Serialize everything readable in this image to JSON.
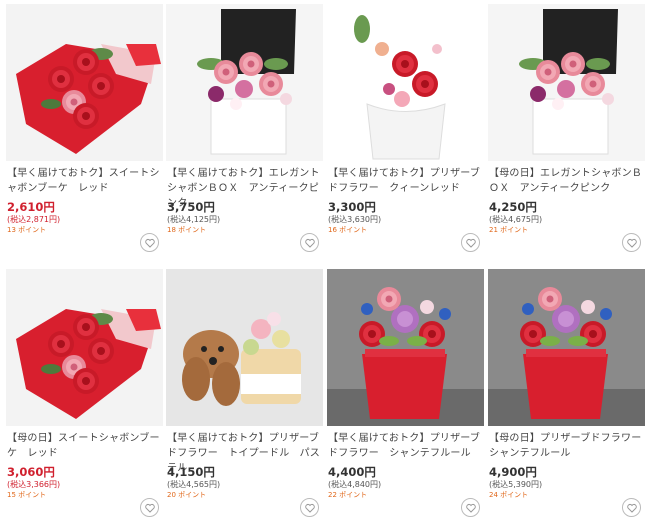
{
  "products": [
    {
      "name": "【早く届けておトク】スイートシャボンブーケ　レッド",
      "price": "2,610円",
      "tax": "(税込2,871円)",
      "points": "13 ポイント",
      "sale": true,
      "image": "red-soap-bouquet"
    },
    {
      "name": "【早く届けておトク】エレガントシャボンＢＯＸ　アンティークピンク",
      "price": "3,750円",
      "tax": "(税込4,125円)",
      "points": "18 ポイント",
      "sale": false,
      "image": "pink-soap-box"
    },
    {
      "name": "【早く届けておトク】プリザーブドフラワー　クィーンレッド",
      "price": "3,300円",
      "tax": "(税込3,630円)",
      "points": "16 ポイント",
      "sale": false,
      "image": "red-preserved-pot"
    },
    {
      "name": "【母の日】エレガントシャボンＢＯＸ　アンティークピンク",
      "price": "4,250円",
      "tax": "(税込4,675円)",
      "points": "21 ポイント",
      "sale": false,
      "image": "pink-soap-box"
    },
    {
      "name": "【母の日】スイートシャボンブーケ　レッド",
      "price": "3,060円",
      "tax": "(税込3,366円)",
      "points": "15 ポイント",
      "sale": true,
      "image": "red-soap-bouquet"
    },
    {
      "name": "【早く届けておトク】プリザーブドフラワー　トイプードル　パステル",
      "price": "4,150円",
      "tax": "(税込4,565円)",
      "points": "20 ポイント",
      "sale": false,
      "image": "toy-poodle-pastel"
    },
    {
      "name": "【早く届けておトク】プリザーブドフラワー　シャンテフルール",
      "price": "4,400円",
      "tax": "(税込4,840円)",
      "points": "22 ポイント",
      "sale": false,
      "image": "chante-fleur"
    },
    {
      "name": "【母の日】プリザーブドフラワー　シャンテフルール",
      "price": "4,900円",
      "tax": "(税込5,390円)",
      "points": "24 ポイント",
      "sale": false,
      "image": "chante-fleur"
    }
  ],
  "favorite_icon": "heart-icon",
  "colors": {
    "sale_price": "#d0202e",
    "points": "#e0671a"
  }
}
